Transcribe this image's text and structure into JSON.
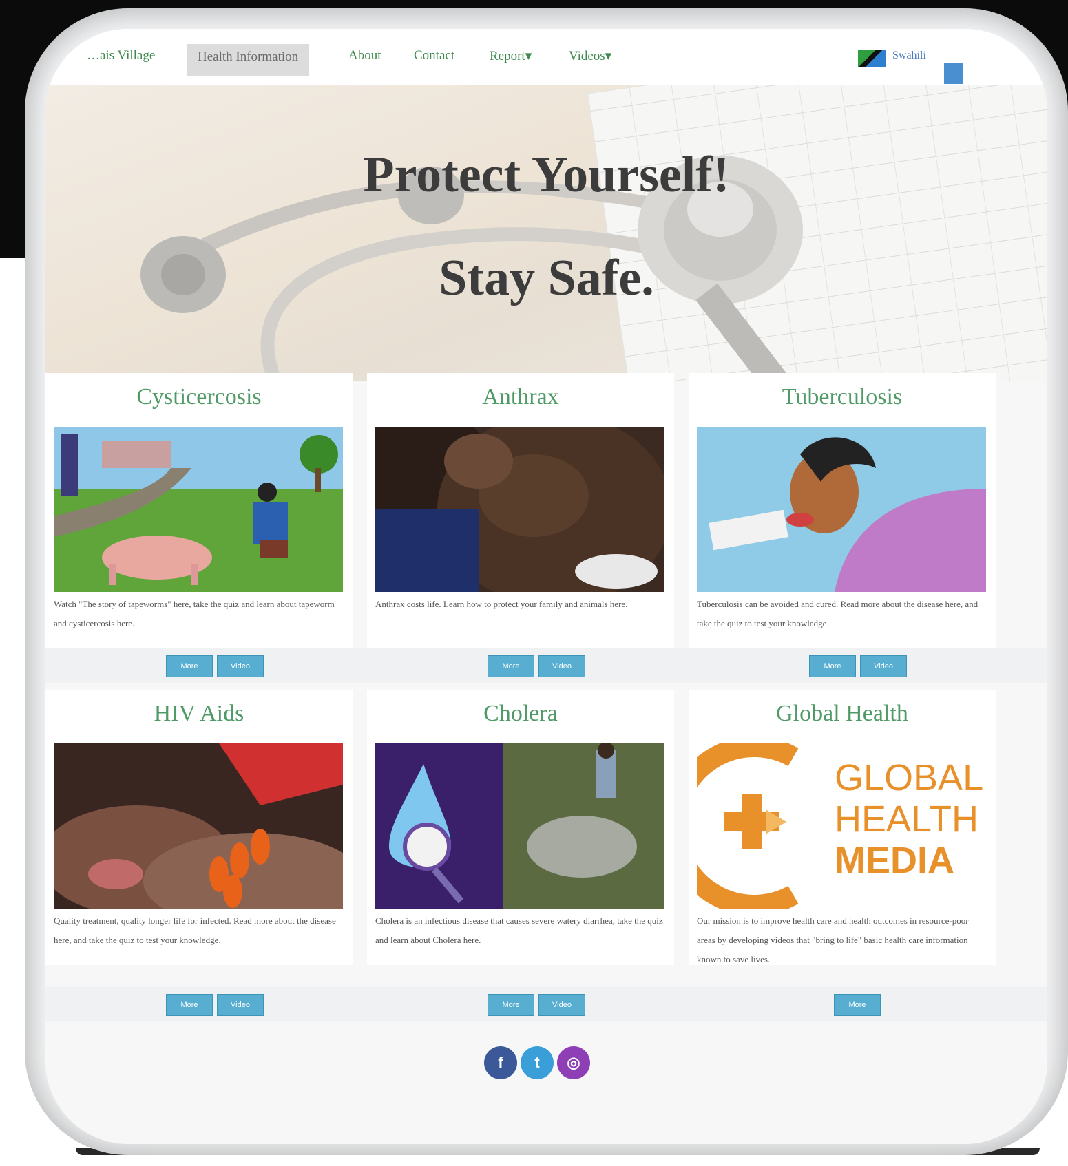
{
  "nav": {
    "brand": "…ais Village",
    "items": [
      "Health Information",
      "About",
      "Contact",
      "Report▾",
      "Videos▾"
    ],
    "language": "Swahili"
  },
  "hero": {
    "line1": "Protect Yourself!",
    "line2": "Stay Safe."
  },
  "cards": [
    {
      "title": "Cysticercosis",
      "description": "Watch \"The story of tapeworms\" here, take the quiz and learn about tapeworm and cysticercosis here.",
      "buttons": [
        "More",
        "Video"
      ]
    },
    {
      "title": "Anthrax",
      "description": "Anthrax costs life. Learn how to protect your family and animals here.",
      "buttons": [
        "More",
        "Video"
      ]
    },
    {
      "title": "Tuberculosis",
      "description": "Tuberculosis can be avoided and cured. Read more about the disease here, and take the quiz to test your knowledge.",
      "buttons": [
        "More",
        "Video"
      ]
    },
    {
      "title": "HIV Aids",
      "description": "Quality treatment, quality longer life for infected. Read more about the disease here, and take the quiz to test your knowledge.",
      "buttons": [
        "More",
        "Video"
      ]
    },
    {
      "title": "Cholera",
      "description": "Cholera is an infectious disease that causes severe watery diarrhea, take the quiz and learn about Cholera here.",
      "buttons": [
        "More",
        "Video"
      ]
    },
    {
      "title": "Global Health",
      "description": "Our mission is to improve health care and health outcomes in resource-poor areas by developing videos that \"bring to life\" basic health care information known to save lives.",
      "buttons": [
        "More"
      ],
      "logo_text": [
        "GLOBAL",
        "HEALTH",
        "MEDIA"
      ]
    }
  ],
  "social": [
    {
      "name": "facebook",
      "glyph": "f",
      "color": "#3b5998"
    },
    {
      "name": "twitter",
      "glyph": "t",
      "color": "#3a9fd8"
    },
    {
      "name": "instagram",
      "glyph": "◎",
      "color": "#8e3fb5"
    }
  ],
  "colors": {
    "nav_link": "#3f8a4e",
    "card_title": "#4f9a66",
    "button": "#57aed0",
    "global_health_orange": "#e8902a"
  }
}
